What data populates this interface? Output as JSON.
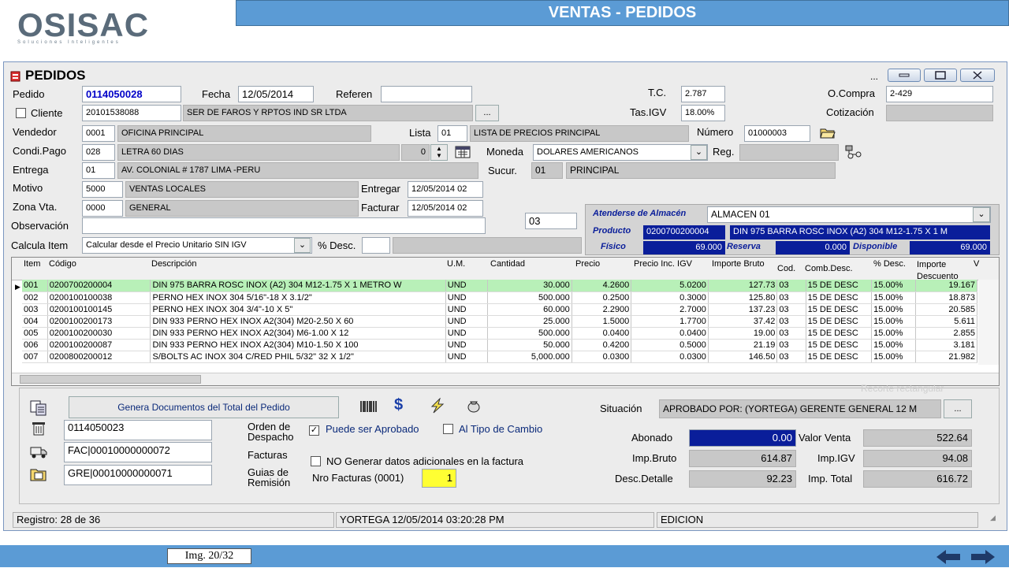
{
  "slide": {
    "title": "VENTAS - PEDIDOS",
    "logo": "OSISAC",
    "logo_tagline": "Soluciones Inteligentes",
    "image_counter": "Img. 20/32"
  },
  "window": {
    "title": "PEDIDOS",
    "dots": "..."
  },
  "header": {
    "pedido_label": "Pedido",
    "pedido": "0114050028",
    "fecha_label": "Fecha",
    "fecha": "12/05/2014",
    "referen_label": "Referen",
    "referen": "",
    "tc_label": "T.C.",
    "tc": "2.787",
    "ocompra_label": "O.Compra",
    "ocompra": "2-429",
    "cliente_label": "Cliente",
    "cliente_ruc": "20101538088",
    "cliente_name": "SER DE FAROS Y RPTOS IND SR LTDA",
    "tasigv_label": "Tas.IGV",
    "tasigv": "18.00%",
    "cotizacion_label": "Cotización",
    "vendedor_label": "Vendedor",
    "vendedor_code": "0001",
    "vendedor_name": "OFICINA PRINCIPAL",
    "lista_label": "Lista",
    "lista_code": "01",
    "lista_name": "LISTA DE PRECIOS PRINCIPAL",
    "numero_label": "Número",
    "numero": "01000003",
    "condpago_label": "Condi.Pago",
    "condpago_code": "028",
    "condpago_name": "LETRA 60 DIAS",
    "condpago_spin": "0",
    "moneda_label": "Moneda",
    "moneda": "DOLARES AMERICANOS",
    "reg_label": "Reg.",
    "entrega_label": "Entrega",
    "entrega_code": "01",
    "entrega_name": "AV. COLONIAL # 1787 LIMA -PERU",
    "sucur_label": "Sucur.",
    "sucur_code": "01",
    "sucur_name": "PRINCIPAL",
    "motivo_label": "Motivo",
    "motivo_code": "5000",
    "motivo_name": "VENTAS LOCALES",
    "entregar_label": "Entregar",
    "entregar": "12/05/2014 02",
    "zona_label": "Zona Vta.",
    "zona_code": "0000",
    "zona_name": "GENERAL",
    "facturar_label": "Facturar",
    "facturar": "12/05/2014 02",
    "observacion_label": "Observación",
    "observacion": "",
    "calcula_label": "Calcula Item",
    "calcula": "Calcular desde el Precio Unitario SIN IGV",
    "desc_label": "% Desc.",
    "box03": "03"
  },
  "almacen": {
    "label": "Atenderse de Almacén",
    "value": "ALMACEN 01",
    "producto_label": "Producto",
    "producto_code": "0200700200004",
    "producto_desc": "DIN 975 BARRA ROSC INOX (A2) 304 M12-1.75 X 1 M",
    "fisico_label": "Físico",
    "fisico": "69.000",
    "reserva_label": "Reserva",
    "reserva": "0.000",
    "disponible_label": "Disponible",
    "disponible": "69.000"
  },
  "grid": {
    "headers": [
      "Item",
      "Código",
      "Descripción",
      "U.M.",
      "Cantidad",
      "Precio",
      "Precio Inc. IGV",
      "Importe Bruto",
      "Cod.",
      "Comb.Desc.",
      "% Desc.",
      "Importe Descuento",
      "V"
    ],
    "rows": [
      [
        "001",
        "0200700200004",
        "DIN 975 BARRA ROSC INOX (A2) 304 M12-1.75 X 1 METRO W",
        "UND",
        "30.000",
        "4.2600",
        "5.0200",
        "127.73",
        "03",
        "15  DE DESC",
        "15.00%",
        "19.167"
      ],
      [
        "002",
        "0200100100038",
        "PERNO HEX INOX 304 5/16\"-18 X 3.1/2\"",
        "UND",
        "500.000",
        "0.2500",
        "0.3000",
        "125.80",
        "03",
        "15  DE DESC",
        "15.00%",
        "18.873"
      ],
      [
        "003",
        "0200100100145",
        "PERNO HEX INOX 304 3/4\"-10 X 5\"",
        "UND",
        "60.000",
        "2.2900",
        "2.7000",
        "137.23",
        "03",
        "15  DE DESC",
        "15.00%",
        "20.585"
      ],
      [
        "004",
        "0200100200173",
        "DIN 933 PERNO HEX INOX A2(304) M20-2.50 X 60",
        "UND",
        "25.000",
        "1.5000",
        "1.7700",
        "37.42",
        "03",
        "15  DE DESC",
        "15.00%",
        "5.611"
      ],
      [
        "005",
        "0200100200030",
        "DIN 933 PERNO HEX INOX A2(304) M6-1.00 X 12",
        "UND",
        "500.000",
        "0.0400",
        "0.0400",
        "19.00",
        "03",
        "15  DE DESC",
        "15.00%",
        "2.855"
      ],
      [
        "006",
        "0200100200087",
        "DIN 933 PERNO HEX INOX A2(304) M10-1.50 X 100",
        "UND",
        "50.000",
        "0.4200",
        "0.5000",
        "21.19",
        "03",
        "15  DE DESC",
        "15.00%",
        "3.181"
      ],
      [
        "007",
        "0200800200012",
        "S/BOLTS AC INOX 304 C/RED PHIL 5/32\" 32 X 1/2\"",
        "UND",
        "5,000.000",
        "0.0300",
        "0.0300",
        "146.50",
        "03",
        "15  DE DESC",
        "15.00%",
        "21.982"
      ]
    ]
  },
  "bottom": {
    "genera_btn": "Genera Documentos del Total del Pedido",
    "dollar_icon": "$",
    "situacion_label": "Situación",
    "situacion": "APROBADO POR: (YORTEGA) GERENTE GENERAL 12 M",
    "doc1": "0114050023",
    "doc2": "FAC|00010000000072",
    "doc3": "GRE|00010000000071",
    "orden_label": "Orden de Despacho",
    "facturas_label": "Facturas",
    "guias_label": "Guias de Remisión",
    "puede_label": "Puede ser Aprobado",
    "tipo_cambio_label": "Al Tipo de Cambio",
    "no_generar_label": "NO Generar datos adicionales en la factura",
    "nro_facturas_label": "Nro Facturas (0001)",
    "nro_facturas": "1",
    "abonado_label": "Abonado",
    "abonado": "0.00",
    "valor_venta_label": "Valor Venta",
    "valor_venta": "522.64",
    "imp_bruto_label": "Imp.Bruto",
    "imp_bruto": "614.87",
    "imp_igv_label": "Imp.IGV",
    "imp_igv": "94.08",
    "desc_detalle_label": "Desc.Detalle",
    "desc_detalle": "92.23",
    "imp_total_label": "Imp. Total",
    "imp_total": "616.72",
    "ghost_tooltip": "Recorte rectangular"
  },
  "statusbar": {
    "registro": "Registro: 28 de 36",
    "user": "YORTEGA 12/05/2014 03:20:28 PM",
    "mode": "EDICION"
  }
}
